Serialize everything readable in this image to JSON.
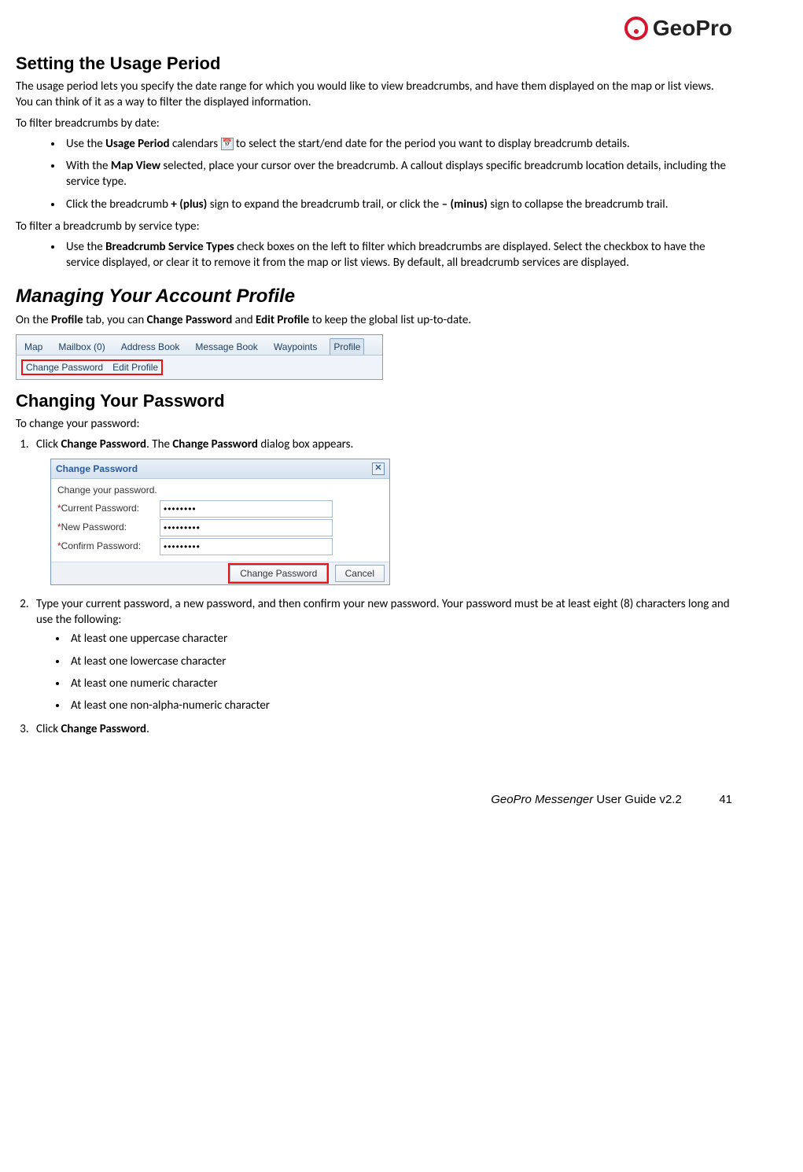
{
  "brand": {
    "name": "GeoPro"
  },
  "section1": {
    "title": "Setting the Usage Period",
    "intro": "The usage period lets you specify the date range for which you would like to view breadcrumbs, and have them displayed on the map or list views. You can think of it as a way to filter the displayed information.",
    "lead1": "To filter breadcrumbs by date:",
    "b1_pre": "Use the ",
    "b1_bold": "Usage Period",
    "b1_mid": " calendars ",
    "b1_post": " to select the start/end date for the period you want to display breadcrumb details.",
    "b2_pre": "With the ",
    "b2_bold": "Map View",
    "b2_post": " selected, place your cursor over the breadcrumb. A callout displays specific breadcrumb location details, including the service type.",
    "b3_pre": "Click the breadcrumb ",
    "b3_bold1": "+ (plus)",
    "b3_mid": " sign to expand the breadcrumb trail, or click the ",
    "b3_bold2": "– (minus)",
    "b3_post": " sign to collapse the breadcrumb trail.",
    "lead2": "To filter a breadcrumb by service type:",
    "b4_pre": "Use the ",
    "b4_bold": "Breadcrumb Service Types",
    "b4_post": " check boxes on the left to filter which breadcrumbs are displayed. Select the checkbox to have the service displayed, or clear it to remove it from the map or list views. By default, all breadcrumb services are displayed."
  },
  "section2": {
    "title": "Managing Your Account Profile",
    "p_pre": "On the ",
    "p_b1": "Profile",
    "p_mid1": " tab, you can ",
    "p_b2": "Change Password",
    "p_mid2": " and ",
    "p_b3": "Edit Profile",
    "p_post": " to keep the global list up-to-date."
  },
  "tabs": {
    "t1": "Map",
    "t2": "Mailbox (0)",
    "t3": "Address Book",
    "t4": "Message Book",
    "t5": "Waypoints",
    "t6": "Profile",
    "sub1": "Change Password",
    "sub2": "Edit Profile"
  },
  "section3": {
    "title": "Changing Your Password",
    "lead": "To change your password:",
    "s1_pre": "Click ",
    "s1_b1": "Change Password",
    "s1_mid": ". The ",
    "s1_b2": "Change Password",
    "s1_post": " dialog box appears.",
    "s2": "Type your current password, a new password, and then confirm your new password. Your password must be at least eight (8) characters long and use the following:",
    "r1": "At least one uppercase character",
    "r2": "At least one lowercase character",
    "r3": "At least one numeric character",
    "r4": "At least one non-alpha-numeric character",
    "s3_pre": "Click ",
    "s3_b": "Change Password",
    "s3_post": "."
  },
  "dialog": {
    "title": "Change Password",
    "caption": "Change your password.",
    "label_current": "Current Password:",
    "label_new": "New Password:",
    "label_confirm": "Confirm Password:",
    "val_current": "••••••••",
    "val_new": "•••••••••",
    "val_confirm": "•••••••••",
    "btn_change": "Change Password",
    "btn_cancel": "Cancel",
    "close": "✕"
  },
  "footer": {
    "doc_title_italic": "GeoPro Messenger",
    "doc_title_rest": " User Guide v2.2",
    "page": "41"
  }
}
